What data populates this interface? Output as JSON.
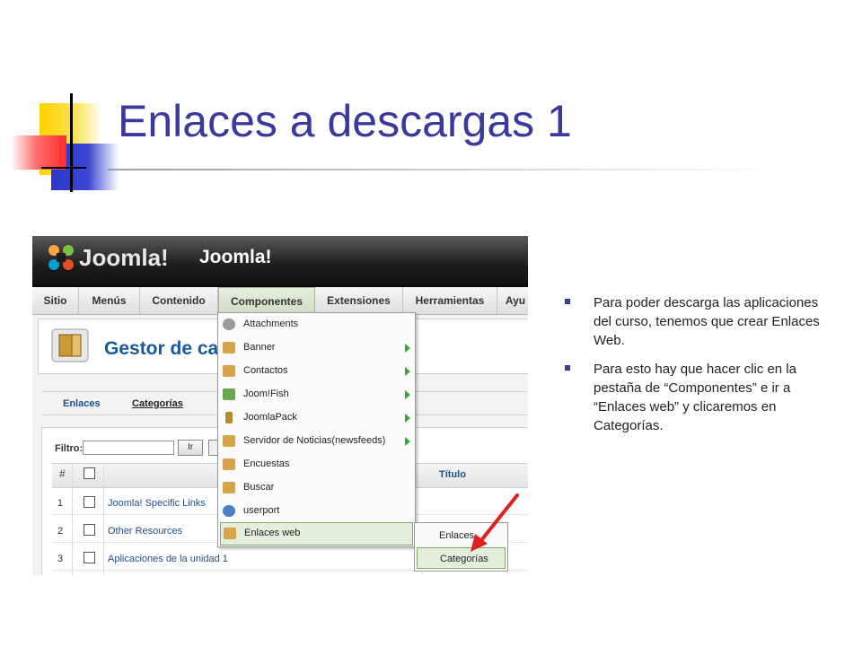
{
  "slide": {
    "title": "Enlaces a descargas 1",
    "bullets": [
      "Para poder descarga las aplicaciones del curso, tenemos que crear Enlaces Web.",
      "Para esto hay que hacer clic en la pestaña de “Componentes” e ir a “Enlaces web” y clicaremos en Categorías."
    ],
    "accent_color": "#3a3a9e"
  },
  "screenshot": {
    "header": {
      "logo_text": "Joomla!",
      "site_name": "Joomla!"
    },
    "menu": [
      "Sitio",
      "Menús",
      "Contenido",
      "Componentes",
      "Extensiones",
      "Herramientas",
      "Ayu"
    ],
    "active_menu": "Componentes",
    "page_title": "Gestor de ca",
    "subtabs": [
      "Enlaces",
      "Categorías"
    ],
    "filter": {
      "label": "Filtro:",
      "button": "Ir"
    },
    "table": {
      "headers": {
        "num": "#",
        "title": "Título"
      },
      "rows": [
        {
          "num": "1",
          "title": "Joomla! Specific Links"
        },
        {
          "num": "2",
          "title": "Other Resources"
        },
        {
          "num": "3",
          "title": "Aplicaciones de la unidad 1"
        }
      ]
    },
    "components_dropdown": [
      {
        "label": "Attachments",
        "icon": "paperclip-icon",
        "submenu": false
      },
      {
        "label": "Banner",
        "icon": "box-icon",
        "submenu": true
      },
      {
        "label": "Contactos",
        "icon": "box-icon",
        "submenu": true
      },
      {
        "label": "Joom!Fish",
        "icon": "fish-icon",
        "submenu": true
      },
      {
        "label": "JoomlaPack",
        "icon": "pack-icon",
        "submenu": true
      },
      {
        "label": "Servidor de Noticias(newsfeeds)",
        "icon": "box-icon",
        "submenu": true
      },
      {
        "label": "Encuestas",
        "icon": "box-icon",
        "submenu": false
      },
      {
        "label": "Buscar",
        "icon": "box-icon",
        "submenu": false
      },
      {
        "label": "userport",
        "icon": "users-icon",
        "submenu": false
      },
      {
        "label": "Enlaces web",
        "icon": "box-icon",
        "submenu": false
      }
    ],
    "weblinks_submenu": [
      "Enlaces",
      "Categorías"
    ]
  }
}
